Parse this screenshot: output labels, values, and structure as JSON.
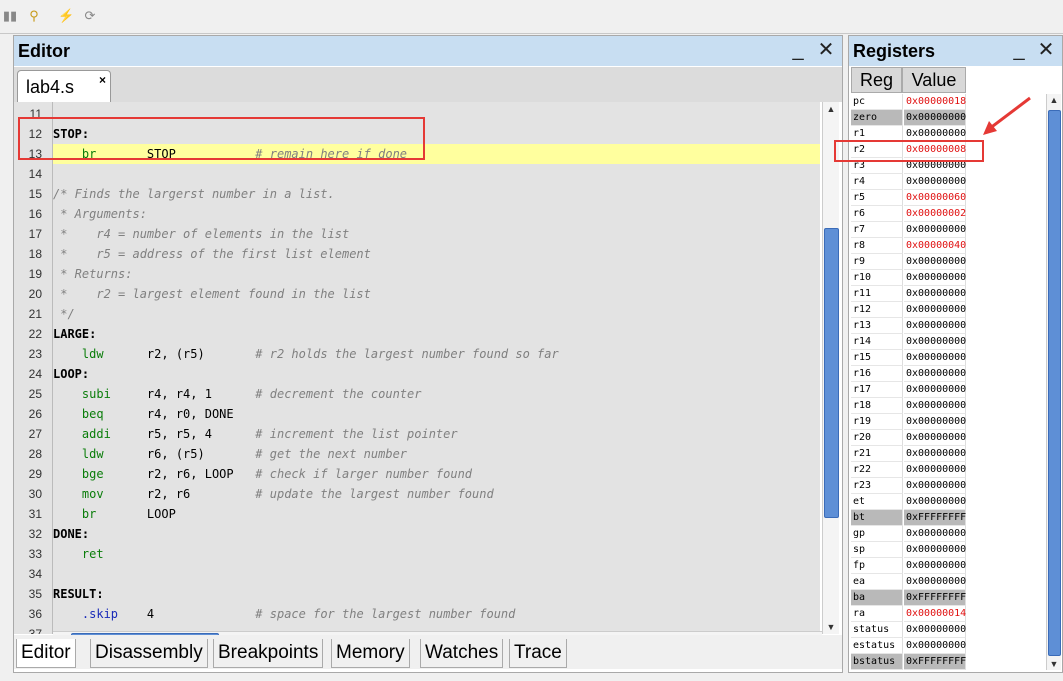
{
  "toolbar": {
    "icons": [
      "pause-icon",
      "debug-icon",
      "disconnect-icon",
      "refresh-icon"
    ]
  },
  "editor": {
    "title": "Editor",
    "minimize_label": "_",
    "close_label": "✕",
    "file_tab": "lab4.s",
    "file_tab_close": "×",
    "lines": [
      {
        "n": "11",
        "parts": []
      },
      {
        "n": "12",
        "parts": [
          {
            "t": "lb",
            "s": "STOP:"
          }
        ]
      },
      {
        "n": "13",
        "parts": [
          {
            "t": "k",
            "s": "    br       "
          },
          {
            "t": "",
            "s": "STOP           "
          },
          {
            "t": "c",
            "s": "# remain here if done"
          }
        ]
      },
      {
        "n": "14",
        "parts": []
      },
      {
        "n": "15",
        "parts": [
          {
            "t": "c",
            "s": "/* Finds the largerst number in a list."
          }
        ]
      },
      {
        "n": "16",
        "parts": [
          {
            "t": "c",
            "s": " * Arguments:"
          }
        ]
      },
      {
        "n": "17",
        "parts": [
          {
            "t": "c",
            "s": " *    r4 = number of elements in the list"
          }
        ]
      },
      {
        "n": "18",
        "parts": [
          {
            "t": "c",
            "s": " *    r5 = address of the first list element"
          }
        ]
      },
      {
        "n": "19",
        "parts": [
          {
            "t": "c",
            "s": " * Returns:"
          }
        ]
      },
      {
        "n": "20",
        "parts": [
          {
            "t": "c",
            "s": " *    r2 = largest element found in the list"
          }
        ]
      },
      {
        "n": "21",
        "parts": [
          {
            "t": "c",
            "s": " */"
          }
        ]
      },
      {
        "n": "22",
        "parts": [
          {
            "t": "lb",
            "s": "LARGE:"
          }
        ]
      },
      {
        "n": "23",
        "parts": [
          {
            "t": "k",
            "s": "    ldw      "
          },
          {
            "t": "",
            "s": "r2, (r5)       "
          },
          {
            "t": "c",
            "s": "# r2 holds the largest number found so far"
          }
        ]
      },
      {
        "n": "24",
        "parts": [
          {
            "t": "lb",
            "s": "LOOP:"
          }
        ]
      },
      {
        "n": "25",
        "parts": [
          {
            "t": "k",
            "s": "    subi     "
          },
          {
            "t": "",
            "s": "r4, r4, 1      "
          },
          {
            "t": "c",
            "s": "# decrement the counter"
          }
        ]
      },
      {
        "n": "26",
        "parts": [
          {
            "t": "k",
            "s": "    beq      "
          },
          {
            "t": "",
            "s": "r4, r0, DONE"
          }
        ]
      },
      {
        "n": "27",
        "parts": [
          {
            "t": "k",
            "s": "    addi     "
          },
          {
            "t": "",
            "s": "r5, r5, 4      "
          },
          {
            "t": "c",
            "s": "# increment the list pointer"
          }
        ]
      },
      {
        "n": "28",
        "parts": [
          {
            "t": "k",
            "s": "    ldw      "
          },
          {
            "t": "",
            "s": "r6, (r5)       "
          },
          {
            "t": "c",
            "s": "# get the next number"
          }
        ]
      },
      {
        "n": "29",
        "parts": [
          {
            "t": "k",
            "s": "    bge      "
          },
          {
            "t": "",
            "s": "r2, r6, LOOP   "
          },
          {
            "t": "c",
            "s": "# check if larger number found"
          }
        ]
      },
      {
        "n": "30",
        "parts": [
          {
            "t": "k",
            "s": "    mov      "
          },
          {
            "t": "",
            "s": "r2, r6         "
          },
          {
            "t": "c",
            "s": "# update the largest number found"
          }
        ]
      },
      {
        "n": "31",
        "parts": [
          {
            "t": "k",
            "s": "    br       "
          },
          {
            "t": "",
            "s": "LOOP"
          }
        ]
      },
      {
        "n": "32",
        "parts": [
          {
            "t": "lb",
            "s": "DONE:"
          }
        ]
      },
      {
        "n": "33",
        "parts": [
          {
            "t": "k",
            "s": "    ret"
          }
        ]
      },
      {
        "n": "34",
        "parts": []
      },
      {
        "n": "35",
        "parts": [
          {
            "t": "lb",
            "s": "RESULT:"
          }
        ]
      },
      {
        "n": "36",
        "parts": [
          {
            "t": "d",
            "s": "    .skip    "
          },
          {
            "t": "",
            "s": "4              "
          },
          {
            "t": "c",
            "s": "# space for the largest number found"
          }
        ]
      },
      {
        "n": "37",
        "parts": []
      }
    ],
    "highlighted_line": "13",
    "bottom_tabs": [
      "Editor",
      "Disassembly",
      "Breakpoints",
      "Memory",
      "Watches",
      "Trace"
    ],
    "active_tab": "Editor"
  },
  "registers": {
    "title": "Registers",
    "minimize_label": "_",
    "close_label": "✕",
    "col_reg": "Reg",
    "col_value": "Value",
    "rows": [
      {
        "name": "pc",
        "value": "0x00000018",
        "changed": true,
        "grey": false
      },
      {
        "name": "zero",
        "value": "0x00000000",
        "changed": false,
        "grey": true
      },
      {
        "name": "r1",
        "value": "0x00000000",
        "changed": false,
        "grey": false
      },
      {
        "name": "r2",
        "value": "0x00000008",
        "changed": true,
        "grey": false
      },
      {
        "name": "r3",
        "value": "0x00000000",
        "changed": false,
        "grey": false
      },
      {
        "name": "r4",
        "value": "0x00000000",
        "changed": false,
        "grey": false
      },
      {
        "name": "r5",
        "value": "0x00000060",
        "changed": true,
        "grey": false
      },
      {
        "name": "r6",
        "value": "0x00000002",
        "changed": true,
        "grey": false
      },
      {
        "name": "r7",
        "value": "0x00000000",
        "changed": false,
        "grey": false
      },
      {
        "name": "r8",
        "value": "0x00000040",
        "changed": true,
        "grey": false
      },
      {
        "name": "r9",
        "value": "0x00000000",
        "changed": false,
        "grey": false
      },
      {
        "name": "r10",
        "value": "0x00000000",
        "changed": false,
        "grey": false
      },
      {
        "name": "r11",
        "value": "0x00000000",
        "changed": false,
        "grey": false
      },
      {
        "name": "r12",
        "value": "0x00000000",
        "changed": false,
        "grey": false
      },
      {
        "name": "r13",
        "value": "0x00000000",
        "changed": false,
        "grey": false
      },
      {
        "name": "r14",
        "value": "0x00000000",
        "changed": false,
        "grey": false
      },
      {
        "name": "r15",
        "value": "0x00000000",
        "changed": false,
        "grey": false
      },
      {
        "name": "r16",
        "value": "0x00000000",
        "changed": false,
        "grey": false
      },
      {
        "name": "r17",
        "value": "0x00000000",
        "changed": false,
        "grey": false
      },
      {
        "name": "r18",
        "value": "0x00000000",
        "changed": false,
        "grey": false
      },
      {
        "name": "r19",
        "value": "0x00000000",
        "changed": false,
        "grey": false
      },
      {
        "name": "r20",
        "value": "0x00000000",
        "changed": false,
        "grey": false
      },
      {
        "name": "r21",
        "value": "0x00000000",
        "changed": false,
        "grey": false
      },
      {
        "name": "r22",
        "value": "0x00000000",
        "changed": false,
        "grey": false
      },
      {
        "name": "r23",
        "value": "0x00000000",
        "changed": false,
        "grey": false
      },
      {
        "name": "et",
        "value": "0x00000000",
        "changed": false,
        "grey": false
      },
      {
        "name": "bt",
        "value": "0xFFFFFFFF",
        "changed": false,
        "grey": true
      },
      {
        "name": "gp",
        "value": "0x00000000",
        "changed": false,
        "grey": false
      },
      {
        "name": "sp",
        "value": "0x00000000",
        "changed": false,
        "grey": false
      },
      {
        "name": "fp",
        "value": "0x00000000",
        "changed": false,
        "grey": false
      },
      {
        "name": "ea",
        "value": "0x00000000",
        "changed": false,
        "grey": false
      },
      {
        "name": "ba",
        "value": "0xFFFFFFFF",
        "changed": false,
        "grey": true
      },
      {
        "name": "ra",
        "value": "0x00000014",
        "changed": true,
        "grey": false
      },
      {
        "name": "status",
        "value": "0x00000000",
        "changed": false,
        "grey": false
      },
      {
        "name": "estatus",
        "value": "0x00000000",
        "changed": false,
        "grey": false
      },
      {
        "name": "bstatus",
        "value": "0xFFFFFFFF",
        "changed": false,
        "grey": true
      }
    ]
  },
  "colors": {
    "title_bar": "#c8def2",
    "highlight_line": "#ffff9e",
    "annotation_red": "#e53935",
    "changed_value": "#e01010",
    "keyword": "#0a7d0a",
    "comment": "#808080"
  }
}
